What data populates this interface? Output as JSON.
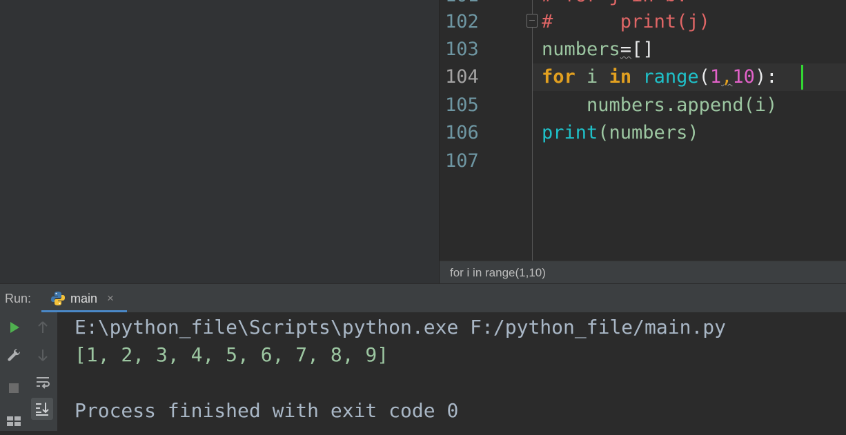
{
  "editor": {
    "partial_top_line": "# for j in b:",
    "lines": [
      {
        "number": "102"
      },
      {
        "number": "103"
      },
      {
        "number": "104"
      },
      {
        "number": "105"
      },
      {
        "number": "106"
      },
      {
        "number": "107"
      }
    ],
    "code": {
      "l102_hash": "#",
      "l102_rest": "      print(j)",
      "l103_var": "numbers",
      "l103_eq": "=",
      "l103_list": "[]",
      "l104_for": "for",
      "l104_i": " i ",
      "l104_in": "in",
      "l104_range": " range",
      "l104_open": "(",
      "l104_n1": "1",
      "l104_comma": ",",
      "l104_n2": "10",
      "l104_close": "):",
      "l105_indent": "    ",
      "l105_obj": "numbers.append",
      "l105_args": "(i)",
      "l106_fn": "print",
      "l106_args": "(numbers)"
    },
    "breadcrumb": "for i in range(1,10)"
  },
  "run_panel": {
    "label": "Run:",
    "tab_label": "main",
    "tab_close": "×"
  },
  "console": {
    "command": "E:\\python_file\\Scripts\\python.exe F:/python_file/main.py",
    "output": "[1, 2, 3, 4, 5, 6, 7, 8, 9]",
    "status": "Process finished with exit code 0"
  },
  "icons": {
    "run": "play-icon",
    "settings": "wrench-icon",
    "stop": "stop-icon",
    "layout": "layout-icon",
    "up": "arrow-up-icon",
    "down": "arrow-down-icon",
    "soft_wrap": "soft-wrap-icon",
    "scroll_to_end": "scroll-to-end-icon"
  },
  "colors": {
    "keyword": "#e2a020",
    "function": "#1fc1c9",
    "number": "#e262c9",
    "comment": "#e06666",
    "accent": "#4a88c7",
    "caret": "#33d633"
  }
}
